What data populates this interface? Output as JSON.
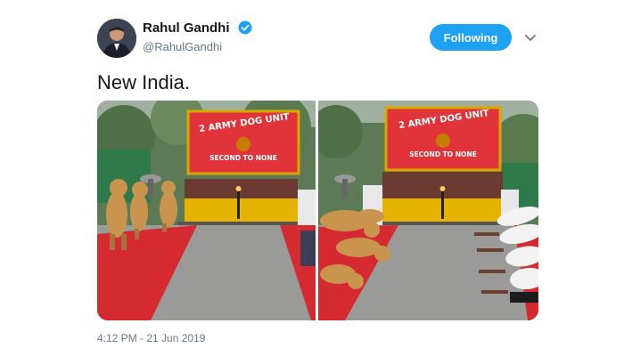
{
  "tweet": {
    "author_name": "Rahul Gandhi",
    "author_handle": "@RahulGandhi",
    "follow_label": "Following",
    "text": "New India.",
    "timestamp": "4:12 PM - 21 Jun 2019"
  },
  "photo": {
    "sign_title": "2 ARMY DOG UNIT",
    "sign_motto": "SECOND TO NONE"
  },
  "icons": {
    "verified": "verified-badge-icon",
    "caret": "chevron-down-icon"
  },
  "colors": {
    "accent": "#1da1f2",
    "text": "#14171a",
    "secondary": "#657786",
    "sign_red": "#e0343a",
    "carpet_red": "#d42a30"
  }
}
